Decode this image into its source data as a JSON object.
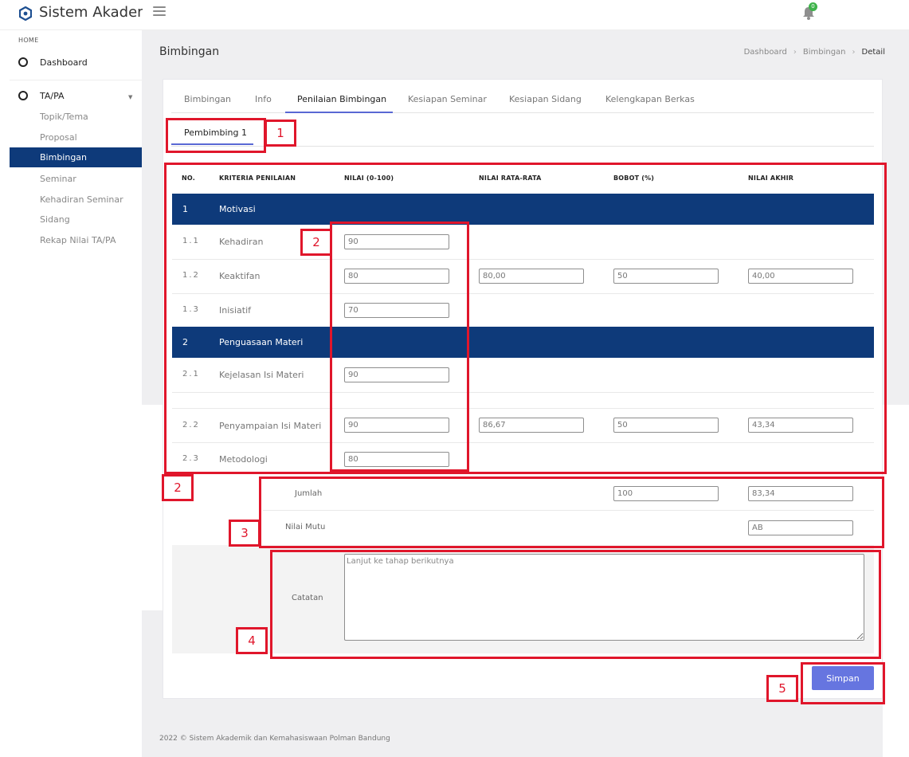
{
  "app": {
    "title": "Sistem Akademik",
    "notification_count": "0"
  },
  "sidebar": {
    "section": "HOME",
    "dashboard": "Dashboard",
    "group": "TA/PA",
    "items": [
      "Topik/Tema",
      "Proposal",
      "Bimbingan",
      "Seminar",
      "Kehadiran Seminar",
      "Sidang",
      "Rekap Nilai TA/PA"
    ],
    "active": "Bimbingan"
  },
  "page": {
    "title": "Bimbingan",
    "breadcrumb": [
      "Dashboard",
      "Bimbingan",
      "Detail"
    ]
  },
  "tabs": [
    "Bimbingan",
    "Info",
    "Penilaian Bimbingan",
    "Kesiapan Seminar",
    "Kesiapan Sidang",
    "Kelengkapan Berkas"
  ],
  "active_tab": "Penilaian Bimbingan",
  "subtab": "Pembimbing 1",
  "table": {
    "headers": [
      "NO.",
      "KRITERIA PENILAIAN",
      "NILAI (0-100)",
      "NILAI RATA-RATA",
      "BOBOT (%)",
      "NILAI AKHIR"
    ],
    "groups": [
      {
        "no": "1",
        "name": "Motivasi",
        "rows": [
          {
            "no": "1.1",
            "name": "Kehadiran",
            "nilai": "90"
          },
          {
            "no": "1.2",
            "name": "Keaktifan",
            "nilai": "80"
          },
          {
            "no": "1.3",
            "name": "Inisiatif",
            "nilai": "70"
          }
        ],
        "rata_rata": "80,00",
        "bobot": "50",
        "akhir": "40,00"
      },
      {
        "no": "2",
        "name": "Penguasaan Materi",
        "rows": [
          {
            "no": "2.1",
            "name": "Kejelasan Isi Materi",
            "nilai": "90"
          },
          {
            "no": "2.2",
            "name": "Penyampaian Isi Materi",
            "nilai": "90"
          },
          {
            "no": "2.3",
            "name": "Metodologi",
            "nilai": "80"
          }
        ],
        "rata_rata": "86,67",
        "bobot": "50",
        "akhir": "43,34"
      }
    ],
    "jumlah_label": "Jumlah",
    "jumlah_bobot": "100",
    "jumlah_akhir": "83,34",
    "mutu_label": "Nilai Mutu",
    "mutu_value": "AB"
  },
  "notes": {
    "label": "Catatan",
    "value": "Lanjut ke tahap berikutnya"
  },
  "save_label": "Simpan",
  "annotations": [
    "1",
    "2",
    "2",
    "3",
    "4",
    "5"
  ],
  "footer": "2022 © Sistem Akademik dan Kemahasiswaan Polman Bandung",
  "colors": {
    "primary": "#0e3a7a",
    "accent": "#6675e0",
    "annotation": "#e0162b",
    "badge": "#3eb34a"
  }
}
